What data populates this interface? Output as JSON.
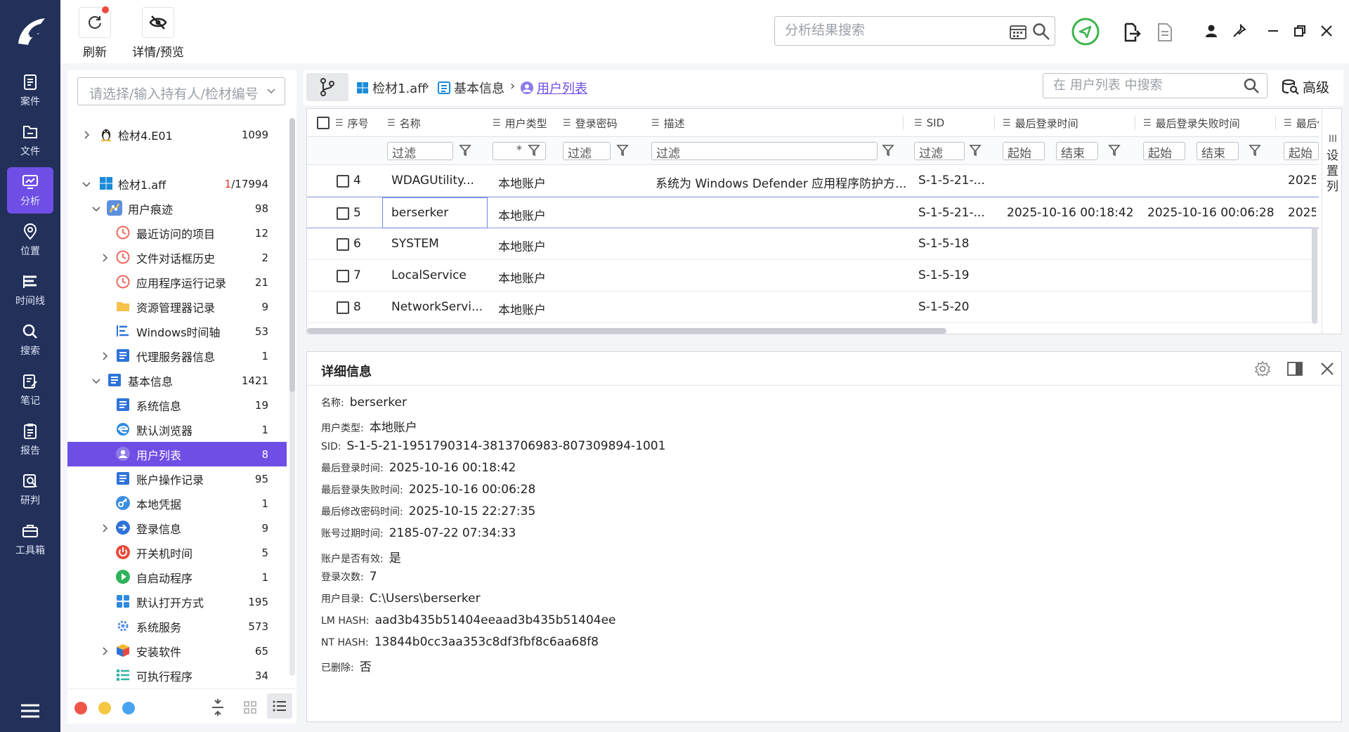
{
  "nav": {
    "items": [
      {
        "label": "案件",
        "icon": "case-icon"
      },
      {
        "label": "文件",
        "icon": "folder-icon"
      },
      {
        "label": "分析",
        "icon": "analysis-icon",
        "active": true
      },
      {
        "label": "位置",
        "icon": "location-icon"
      },
      {
        "label": "时间线",
        "icon": "timeline-icon"
      },
      {
        "label": "搜索",
        "icon": "search-icon"
      },
      {
        "label": "笔记",
        "icon": "notes-icon"
      },
      {
        "label": "报告",
        "icon": "report-icon"
      },
      {
        "label": "研判",
        "icon": "judge-icon"
      },
      {
        "label": "工具箱",
        "icon": "toolbox-icon"
      }
    ]
  },
  "toolbar": {
    "refresh_label": "刷新",
    "preview_label": "详情/预览",
    "search_placeholder": "分析结果搜索"
  },
  "tree": {
    "select_placeholder": "请选择/输入持有人/检材编号",
    "items": [
      {
        "label": "检材4.E01",
        "count": "1099",
        "icon": "linux-icon"
      },
      {
        "label": "检材1.aff",
        "count_red": "1",
        "count_rest": "/17994",
        "icon": "windows-icon"
      },
      {
        "label": "用户痕迹",
        "count": "98",
        "icon": "user-trace-icon"
      },
      {
        "label": "最近访问的项目",
        "count": "12",
        "icon": "clock-icon"
      },
      {
        "label": "文件对话框历史",
        "count": "2",
        "icon": "clock-icon"
      },
      {
        "label": "应用程序运行记录",
        "count": "21",
        "icon": "clock-icon"
      },
      {
        "label": "资源管理器记录",
        "count": "9",
        "icon": "folder-icon"
      },
      {
        "label": "Windows时间轴",
        "count": "53",
        "icon": "timeline-icon"
      },
      {
        "label": "代理服务器信息",
        "count": "1",
        "icon": "list-icon"
      },
      {
        "label": "基本信息",
        "count": "1421",
        "icon": "list-icon"
      },
      {
        "label": "系统信息",
        "count": "19",
        "icon": "list-icon"
      },
      {
        "label": "默认浏览器",
        "count": "1",
        "icon": "browser-icon"
      },
      {
        "label": "用户列表",
        "count": "8",
        "icon": "user-icon"
      },
      {
        "label": "账户操作记录",
        "count": "95",
        "icon": "list-icon"
      },
      {
        "label": "本地凭据",
        "count": "1",
        "icon": "key-icon"
      },
      {
        "label": "登录信息",
        "count": "9",
        "icon": "login-icon"
      },
      {
        "label": "开关机时间",
        "count": "5",
        "icon": "power-icon"
      },
      {
        "label": "自启动程序",
        "count": "1",
        "icon": "play-icon"
      },
      {
        "label": "默认打开方式",
        "count": "195",
        "icon": "apps-icon"
      },
      {
        "label": "系统服务",
        "count": "573",
        "icon": "gear-icon"
      },
      {
        "label": "安装软件",
        "count": "65",
        "icon": "package-icon"
      },
      {
        "label": "可执行程序",
        "count": "34",
        "icon": "exe-icon"
      }
    ]
  },
  "breadcrumb": {
    "items": [
      "检材1.aff",
      "基本信息",
      "用户列表"
    ],
    "search_placeholder": "在 用户列表 中搜索",
    "advanced_label": "高级"
  },
  "table": {
    "columns": [
      "序号",
      "名称",
      "用户类型",
      "登录密码",
      "描述",
      "SID",
      "最后登录时间",
      "最后登录失败时间",
      "最后修"
    ],
    "filter_placeholder": "过滤",
    "filter_star": "*",
    "filter_start": "起始",
    "filter_end": "结束",
    "settings_label": "设置列",
    "rows": [
      {
        "no": "4",
        "name": "WDAGUtility...",
        "type": "本地账户",
        "desc": "系统为 Windows Defender 应用程序防护方...",
        "sid": "S-1-5-21-...",
        "last_login": "",
        "last_fail": "",
        "last_mod": "2025"
      },
      {
        "no": "5",
        "name": "berserker",
        "type": "本地账户",
        "desc": "",
        "sid": "S-1-5-21-...",
        "last_login": "2025-10-16 00:18:42",
        "last_fail": "2025-10-16 00:06:28",
        "last_mod": "2025"
      },
      {
        "no": "6",
        "name": "SYSTEM",
        "type": "本地账户",
        "desc": "",
        "sid": "S-1-5-18",
        "last_login": "",
        "last_fail": "",
        "last_mod": ""
      },
      {
        "no": "7",
        "name": "LocalService",
        "type": "本地账户",
        "desc": "",
        "sid": "S-1-5-19",
        "last_login": "",
        "last_fail": "",
        "last_mod": ""
      },
      {
        "no": "8",
        "name": "NetworkServi...",
        "type": "本地账户",
        "desc": "",
        "sid": "S-1-5-20",
        "last_login": "",
        "last_fail": "",
        "last_mod": ""
      }
    ]
  },
  "detail": {
    "title": "详细信息",
    "fields": [
      {
        "k": "名称:",
        "v": "berserker"
      },
      {
        "k": "用户类型:",
        "v": "本地账户"
      },
      {
        "k": "SID:",
        "v": "S-1-5-21-1951790314-3813706983-807309894-1001"
      },
      {
        "k": "最后登录时间:",
        "v": "2025-10-16 00:18:42"
      },
      {
        "k": "最后登录失败时间:",
        "v": "2025-10-16 00:06:28"
      },
      {
        "k": "最后修改密码时间:",
        "v": "2025-10-15 22:27:35"
      },
      {
        "k": "账号过期时间:",
        "v": "2185-07-22 07:34:33"
      },
      {
        "k": "账户是否有效:",
        "v": "是"
      },
      {
        "k": "登录次数:",
        "v": "7"
      },
      {
        "k": "用户目录:",
        "v": "C:\\Users\\berserker"
      },
      {
        "k": "LM HASH:",
        "v": "aad3b435b51404eeaad3b435b51404ee"
      },
      {
        "k": "NT HASH:",
        "v": "13844b0cc3aa353c8df3fbf8c6aa68f8"
      },
      {
        "k": "已删除:",
        "v": "否"
      }
    ]
  },
  "colors": {
    "nav_bg": "#22305a",
    "accent": "#6f4ee6",
    "brand_green": "#3bb54a"
  }
}
